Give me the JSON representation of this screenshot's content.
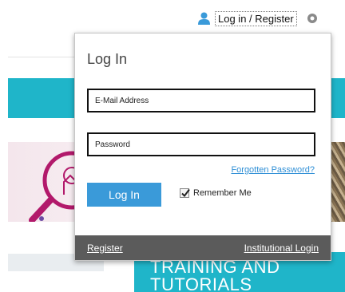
{
  "header": {
    "login_register_label": "Log in / Register",
    "user_icon": "user-icon",
    "toggle_icon": "circle-toggle-icon"
  },
  "login_panel": {
    "title": "Log In",
    "email_placeholder": "E-Mail Address",
    "password_placeholder": "Password",
    "forgot_password_label": "Forgotten Password?",
    "login_button_label": "Log In",
    "remember_me_label": "Remember Me",
    "remember_me_checked": true,
    "footer": {
      "register_label": "Register",
      "institutional_login_label": "Institutional Login"
    }
  },
  "background": {
    "training_text": "TRAINING AND\nTUTORIALS"
  },
  "colors": {
    "accent_blue": "#3a9ad9",
    "link_blue": "#2f8fd6",
    "teal": "#1fb5c9",
    "footer_grey": "#5b5b5b"
  }
}
